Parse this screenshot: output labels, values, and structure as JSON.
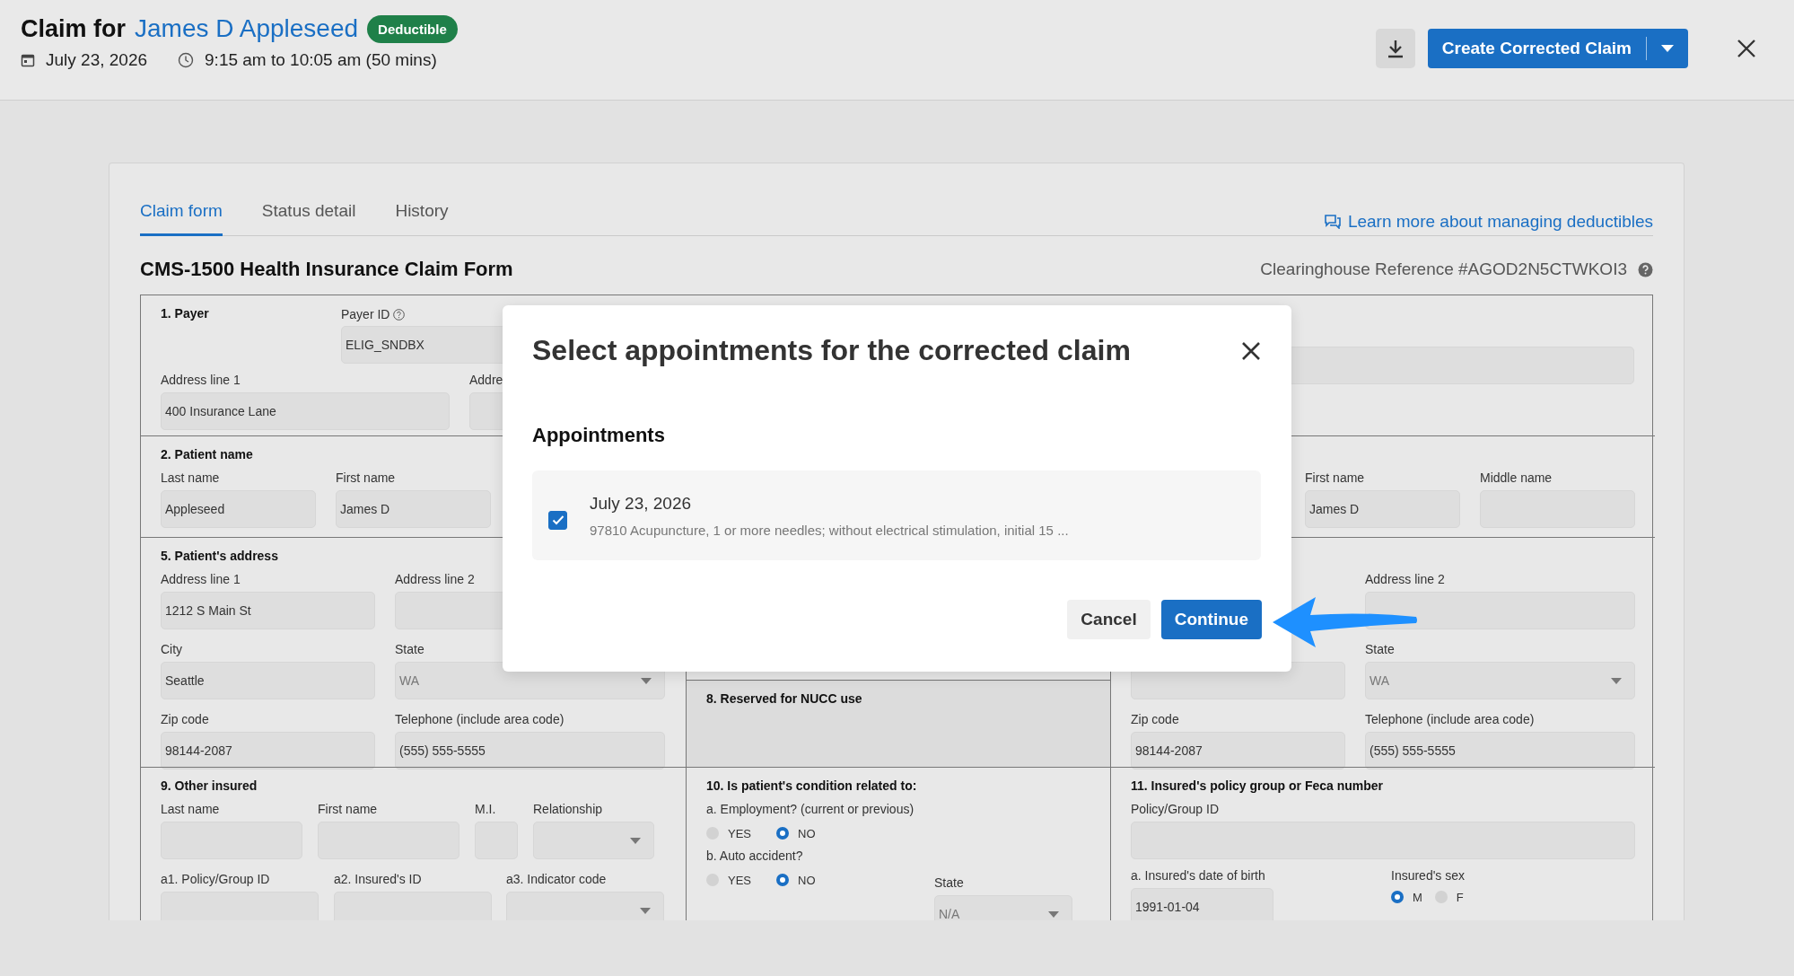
{
  "header": {
    "title_prefix": "Claim for",
    "patient": "James D Appleseed",
    "badge": "Deductible",
    "date": "July 23, 2026",
    "time": "9:15 am to 10:05 am (50 mins)",
    "primary_action": "Create Corrected Claim"
  },
  "tabs": [
    {
      "label": "Claim form",
      "selected": true
    },
    {
      "label": "Status detail",
      "selected": false
    },
    {
      "label": "History",
      "selected": false
    }
  ],
  "help_link": "Learn more about managing deductibles",
  "form": {
    "title": "CMS-1500 Health Insurance Claim Form",
    "reference": "Clearinghouse Reference #AGOD2N5CTWKOI3",
    "payer": {
      "heading": "1. Payer",
      "payer_id_label": "Payer ID",
      "payer_id": "ELIG_SNDBX",
      "address1_label": "Address line 1",
      "address1": "400 Insurance Lane",
      "address2_label": "Addre"
    },
    "patient_name": {
      "heading": "2. Patient name",
      "fields": [
        {
          "label": "Last name",
          "value": "Appleseed"
        },
        {
          "label": "First name",
          "value": "James D"
        }
      ]
    },
    "insured_name": {
      "fields": [
        {
          "label": "First name",
          "value": "James D"
        },
        {
          "label": "Middle name"
        }
      ]
    },
    "patient_address": {
      "heading": "5. Patient's address",
      "fields": [
        {
          "label": "Address line 1",
          "value": "1212 S Main St",
          "kind": "text"
        },
        {
          "label": "Address line 2",
          "kind": "text"
        },
        {
          "label": "City",
          "value": "Seattle",
          "kind": "text"
        },
        {
          "label": "State",
          "value": "WA",
          "kind": "select"
        },
        {
          "label": "Zip code",
          "value": "98144-2087",
          "kind": "text"
        },
        {
          "label": "Telephone (include area code)",
          "value": "(555) 555-5555",
          "kind": "text"
        }
      ]
    },
    "nucc": {
      "heading": "8. Reserved for NUCC use"
    },
    "insured_address": {
      "fields": [
        {
          "label": "Address line 2",
          "kind": "text"
        },
        {
          "kind": "text"
        },
        {
          "label": "State",
          "value": "WA",
          "kind": "select"
        },
        {
          "label": "Zip code",
          "value": "98144-2087",
          "kind": "text"
        },
        {
          "label": "Telephone (include area code)",
          "value": "(555) 555-5555",
          "kind": "text"
        }
      ]
    },
    "other_insured": {
      "heading": "9. Other insured",
      "fields": [
        {
          "label": "Last name",
          "kind": "text"
        },
        {
          "label": "First name",
          "kind": "text"
        },
        {
          "label": "M.I.",
          "kind": "text"
        },
        {
          "label": "Relationship",
          "kind": "select"
        },
        {
          "label": "a1. Policy/Group ID",
          "kind": "text"
        },
        {
          "label": "a2. Insured's ID",
          "kind": "text"
        },
        {
          "label": "a3. Indicator code",
          "kind": "select"
        }
      ]
    },
    "condition": {
      "heading": "10. Is patient's condition related to:",
      "questions": [
        {
          "label": "a. Employment? (current or previous)",
          "options": [
            {
              "label": "YES",
              "selected": false
            },
            {
              "label": "NO",
              "selected": true
            }
          ]
        },
        {
          "label": "b. Auto accident?",
          "options": [
            {
              "label": "YES",
              "selected": false
            },
            {
              "label": "NO",
              "selected": true
            }
          ]
        }
      ],
      "state": {
        "label": "State",
        "value": "N/A",
        "kind": "select"
      }
    },
    "policy": {
      "heading": "11. Insured's policy group or Feca number",
      "policy_label": "Policy/Group ID",
      "dob_label": "a. Insured's date of birth",
      "dob": "1991-01-04",
      "sex_label": "Insured's sex",
      "sex_options": [
        {
          "label": "M",
          "selected": true
        },
        {
          "label": "F",
          "selected": false
        }
      ]
    }
  },
  "dialog": {
    "title": "Select appointments for the corrected claim",
    "section": "Appointments",
    "appointments": [
      {
        "date": "July 23, 2026",
        "description": "97810 Acupuncture, 1 or more needles; without electrical stimulation, initial 15 ...",
        "checked": true
      }
    ],
    "buttons": [
      {
        "label": "Cancel",
        "kind": "secondary"
      },
      {
        "label": "Continue",
        "kind": "primary"
      }
    ]
  }
}
